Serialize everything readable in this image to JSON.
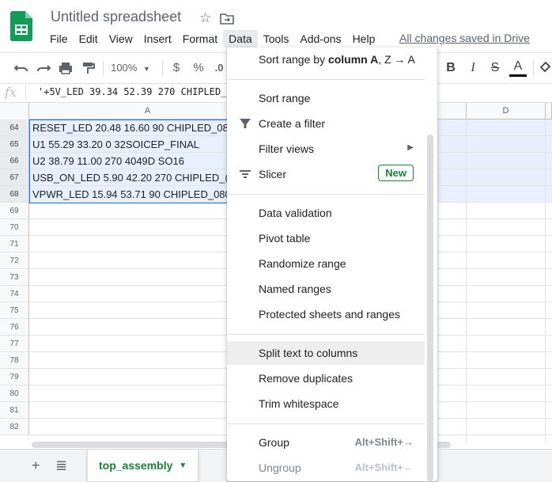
{
  "app": {
    "title": "Untitled spreadsheet",
    "save_status": "All changes saved in Drive"
  },
  "menubar": {
    "items": [
      "File",
      "Edit",
      "View",
      "Insert",
      "Format",
      "Data",
      "Tools",
      "Add-ons",
      "Help"
    ],
    "active": "Data"
  },
  "toolbar": {
    "zoom": "100%",
    "currency": "$",
    "percent": "%",
    "decimal": ".0",
    "bold": "B",
    "strike": "S",
    "text_color": "A"
  },
  "formula_bar": {
    "fx": "fx",
    "content": "'+5V_LED 39.34 52.39 270 CHIPLED_0"
  },
  "grid": {
    "columns": [
      "A",
      "D"
    ],
    "rows": [
      {
        "num": "64",
        "a": "RESET_LED 20.48 16.60 90 CHIPLED_08",
        "selected": true
      },
      {
        "num": "65",
        "a": "U1 55.29 33.20 0 32SOICEP_FINAL",
        "selected": true
      },
      {
        "num": "66",
        "a": "U2 38.79 11.00 270 4049D SO16",
        "selected": true
      },
      {
        "num": "67",
        "a": "USB_ON_LED 5.90 42.20 270 CHIPLED_(",
        "selected": true
      },
      {
        "num": "68",
        "a": "VPWR_LED 15.94 53.71 90 CHIPLED_080",
        "selected": true
      },
      {
        "num": "69",
        "a": "",
        "selected": false
      },
      {
        "num": "70",
        "a": "",
        "selected": false
      },
      {
        "num": "71",
        "a": "",
        "selected": false
      },
      {
        "num": "72",
        "a": "",
        "selected": false
      },
      {
        "num": "73",
        "a": "",
        "selected": false
      },
      {
        "num": "74",
        "a": "",
        "selected": false
      },
      {
        "num": "75",
        "a": "",
        "selected": false
      },
      {
        "num": "76",
        "a": "",
        "selected": false
      },
      {
        "num": "77",
        "a": "",
        "selected": false
      },
      {
        "num": "78",
        "a": "",
        "selected": false
      },
      {
        "num": "79",
        "a": "",
        "selected": false
      },
      {
        "num": "80",
        "a": "",
        "selected": false
      },
      {
        "num": "81",
        "a": "",
        "selected": false
      },
      {
        "num": "82",
        "a": "",
        "selected": false
      }
    ]
  },
  "sheet_tab": {
    "label": "top_assembly"
  },
  "data_menu": {
    "sort_by_prefix": "Sort range by ",
    "sort_by_column": "column A",
    "sort_by_suffix": ", Z → A",
    "sort_range": "Sort range",
    "create_filter": "Create a filter",
    "filter_views": "Filter views",
    "slicer": "Slicer",
    "new_badge": "New",
    "data_validation": "Data validation",
    "pivot_table": "Pivot table",
    "randomize_range": "Randomize range",
    "named_ranges": "Named ranges",
    "protected_sheets": "Protected sheets and ranges",
    "split_text": "Split text to columns",
    "remove_duplicates": "Remove duplicates",
    "trim_whitespace": "Trim whitespace",
    "group": "Group",
    "group_shortcut": "Alt+Shift+→",
    "ungroup": "Ungroup",
    "ungroup_shortcut": "Alt+Shift+←"
  },
  "colors": {
    "accent_green": "#188038",
    "selection_blue": "#1a73e8",
    "selection_fill": "#e8f0fe"
  }
}
